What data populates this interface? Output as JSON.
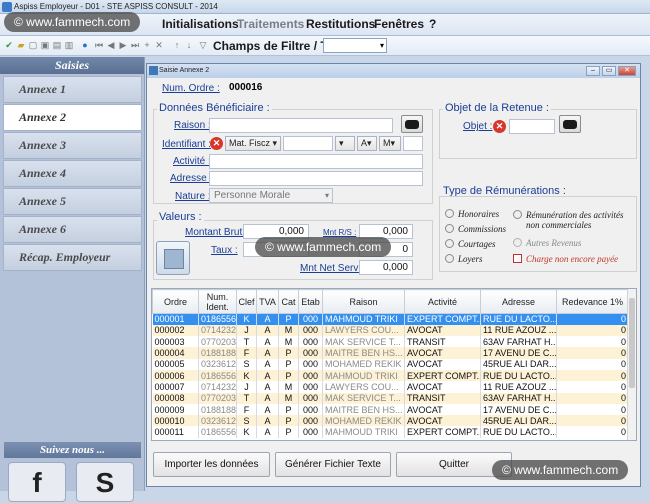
{
  "titlebar": {
    "text": "Aspiss Employeur - D01 - STE ASPISS CONSULT - 2014"
  },
  "menu": [
    {
      "label": "Initialisations",
      "dim": false
    },
    {
      "label": "Traitements",
      "dim": true
    },
    {
      "label": "Restitutions",
      "dim": false
    },
    {
      "label": "Fenêtres",
      "dim": false
    },
    {
      "label": "?",
      "dim": false
    }
  ],
  "toolbar": {
    "filter_label": "Champs de Filtre / Tri",
    "filter_value": ""
  },
  "sidebar": {
    "header": "Saisies",
    "items": [
      "Annexe 1",
      "Annexe 2",
      "Annexe 3",
      "Annexe 4",
      "Annexe 5",
      "Annexe 6",
      "Récap. Employeur"
    ],
    "active_index": 1,
    "follow": "Suivez nous ..."
  },
  "window": {
    "title": "Saisie Annexe 2",
    "num_ordre_label": "Num. Ordre :",
    "num_ordre_value": "000016",
    "section_beneficiaire": "Données Bénéficiaire :",
    "raison_label": "Raison :",
    "identifiant_label": "Identifiant :",
    "id_type": "Mat. Fiscz",
    "id_a": "A",
    "id_m": "M",
    "activite_label": "Activité :",
    "adresse_label": "Adresse :",
    "nature_label": "Nature :",
    "nature_value": "Personne Morale",
    "section_retenue": "Objet de la Retenue :",
    "objet_label": "Objet :",
    "section_remun": "Type de Rémunérations :",
    "remun_types": [
      "Honoraires",
      "Commissions",
      "Courtages",
      "Loyers"
    ],
    "remun_other": "Rémunération des activités non commerciales",
    "autres_revenus": "Autres Revenus",
    "charge": "Charge non encore payée",
    "section_valeurs": "Valeurs :",
    "montant_brut_label": "Montant Brut :",
    "montant_brut_value": "0,000",
    "mnt_rs_label": "Mnt R/S :",
    "mnt_rs_value": "0,000",
    "taux_label": "Taux :",
    "taux_value2": "0",
    "mnt_net_label": "Mnt Net Servi :",
    "mnt_net_value": "0,000"
  },
  "grid": {
    "headers": [
      "Ordre",
      "Num. Ident.",
      "Clef",
      "TVA",
      "Cat",
      "Etab",
      "Raison",
      "Activité",
      "Adresse",
      "Redevance 1%"
    ],
    "rows": [
      [
        "000001",
        "0186556",
        "K",
        "A",
        "P",
        "000",
        "MAHMOUD TRIKI",
        "EXPERT COMPT...",
        "RUE DU LACTO...",
        "0"
      ],
      [
        "000002",
        "0714232",
        "J",
        "A",
        "M",
        "000",
        "LAWYERS  COU...",
        "AVOCAT",
        "11 RUE AZOUZ ...",
        "0"
      ],
      [
        "000003",
        "0770203",
        "T",
        "A",
        "M",
        "000",
        "MAK SERVICE T...",
        "TRANSIT",
        "63AV FARHAT H...",
        "0"
      ],
      [
        "000004",
        "0188188",
        "F",
        "A",
        "P",
        "000",
        "MAITRE BEN HS...",
        "AVOCAT",
        "17 AVENU DE C...",
        "0"
      ],
      [
        "000005",
        "0323612",
        "S",
        "A",
        "P",
        "000",
        "MOHAMED REKIK",
        "AVOCAT",
        "45RUE ALI DAR...",
        "0"
      ],
      [
        "000006",
        "0186556",
        "K",
        "A",
        "P",
        "000",
        "MAHMOUD TRIKI",
        "EXPERT COMPT...",
        "RUE DU LACTO...",
        "0"
      ],
      [
        "000007",
        "0714232",
        "J",
        "A",
        "M",
        "000",
        "LAWYERS  COU...",
        "AVOCAT",
        "11 RUE AZOUZ ...",
        "0"
      ],
      [
        "000008",
        "0770203",
        "T",
        "A",
        "M",
        "000",
        "MAK SERVICE T...",
        "TRANSIT",
        "63AV FARHAT H...",
        "0"
      ],
      [
        "000009",
        "0188188",
        "F",
        "A",
        "P",
        "000",
        "MAITRE BEN HS...",
        "AVOCAT",
        "17 AVENU DE C...",
        "0"
      ],
      [
        "000010",
        "0323612",
        "S",
        "A",
        "P",
        "000",
        "MOHAMED REKIK",
        "AVOCAT",
        "45RUE ALI DAR...",
        "0"
      ],
      [
        "000011",
        "0186556",
        "K",
        "A",
        "P",
        "000",
        "MAHMOUD TRIKI",
        "EXPERT COMPT...",
        "RUE DU LACTO...",
        "0"
      ]
    ]
  },
  "buttons": {
    "import": "Importer les données",
    "generate": "Générer Fichier Texte",
    "quit": "Quitter"
  },
  "watermark": "© www.fammech.com",
  "colors": {
    "selection": "#3390f0",
    "label_blue": "#1a3d96",
    "alt_row": "#fdf2d6"
  }
}
